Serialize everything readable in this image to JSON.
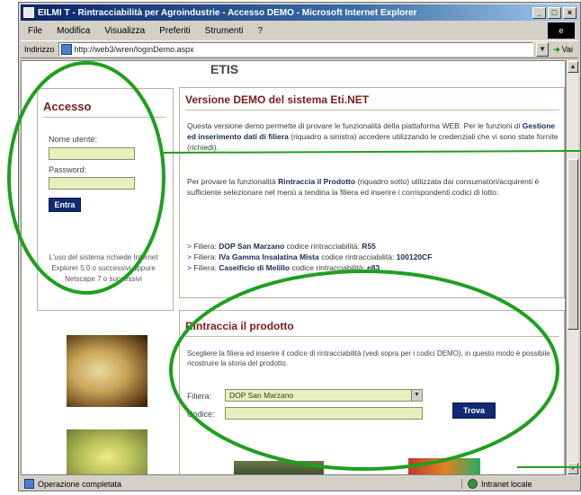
{
  "window": {
    "title": "EILMI T - Rintracciabilità per Agroindustrie - Accesso DEMO - Microsoft Internet Explorer",
    "buttons": [
      "_",
      "□",
      "×"
    ]
  },
  "menubar": {
    "items": [
      "File",
      "Modifica",
      "Visualizza",
      "Preferiti",
      "Strumenti",
      "?"
    ]
  },
  "addressbar": {
    "label": "Indirizzo",
    "url": "http://web3/wren/loginDemo.aspx",
    "go_label": "Vai"
  },
  "statusbar": {
    "text": "Operazione completata",
    "zone": "Intranet locale"
  },
  "page": {
    "top_logo": "ETIS",
    "login": {
      "title": "Accesso",
      "user_label": "Nome utente:",
      "password_label": "Password:",
      "submit_label": "Entra",
      "note": "L'uso del sistema richiede Internet Explorer 5.0 o successivi oppure Netscape 7 o successivi"
    },
    "demo": {
      "title": "Versione DEMO del sistema Eti.NET",
      "para1_a": "Questa versione demo permette di provare le funzionalità della piattaforma WEB. Per le funzioni di ",
      "para1_b": "Gestione ed inserimento dati di filiera",
      "para1_c": " (riquadro a sinistra) accedere utilizzando le credenziali che vi sono state fornite (richiedi).",
      "para2_a": "Per provare la funzionalità ",
      "para2_b": "Rintraccia il Prodotto",
      "para2_c": " (riquadro sotto) utilizzata dai consumatori/acquirenti è sufficiente selezionare nel menù a tendina la filiera ed inserire i corrispondenti codici di lotto:",
      "filiere": [
        {
          "prefix": "> Filiera: ",
          "name": "DOP San Marzano",
          "mid": " codice rintracciabilità: ",
          "code": "R55"
        },
        {
          "prefix": "> Filiera: ",
          "name": "IVa Gamma Insalatina Mista",
          "mid": " codice rintracciabilità: ",
          "code": "100120CF"
        },
        {
          "prefix": "> Filiera: ",
          "name": "Caseificio di Melillo",
          "mid": " codice rintracciabilità: ",
          "code": "e83"
        }
      ]
    },
    "trace": {
      "title": "Rintraccia il prodotto",
      "instructions": "Scegliere la filiera ed inserire il codice di rintracciabilità (vedi sopra per i codici DEMO), in questo modo è possibile ricostruire la storia del prodotto.",
      "filiera_label": "Filiera:",
      "filiera_value": "DOP San Marzano",
      "codice_label": "Codice:",
      "codice_value": "",
      "submit_label": "Trova"
    }
  },
  "colors": {
    "annotation": "#1ea01e",
    "heading": "#7a1c1c",
    "button": "#112a73",
    "input_bg": "#e6f0bc"
  }
}
